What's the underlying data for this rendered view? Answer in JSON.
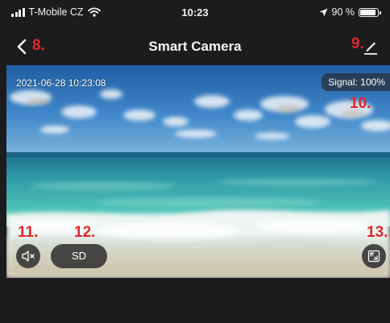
{
  "status_bar": {
    "carrier": "T-Mobile CZ",
    "time": "10:23",
    "battery_text": "90 %",
    "battery_level": 0.9
  },
  "nav": {
    "title": "Smart Camera",
    "back_icon": "chevron-left-icon",
    "edit_icon": "pencil-icon"
  },
  "video": {
    "timestamp": "2021-06-28 10:23:08",
    "signal_label": "Signal: 100%",
    "sd_label": "SD",
    "mute_icon": "speaker-muted-icon",
    "fullscreen_icon": "fullscreen-icon"
  },
  "annotations": {
    "back": "8.",
    "edit": "9.",
    "signal": "10.",
    "mute": "11.",
    "quality": "12.",
    "fullscreen": "13."
  },
  "colors": {
    "background": "#1c1c1e",
    "annotation_red": "#e3262a"
  }
}
